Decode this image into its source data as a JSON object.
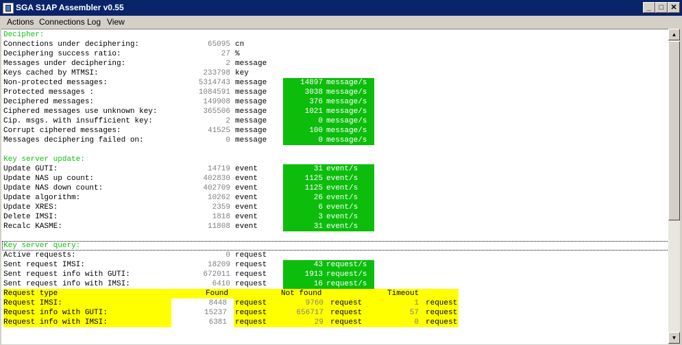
{
  "window": {
    "title": "SGA S1AP Assembler v0.55"
  },
  "titlebar_buttons": {
    "minimize": "_",
    "maximize": "□",
    "close": "✕"
  },
  "menu": [
    "Actions",
    "Connections",
    "Log",
    "View"
  ],
  "icons": {
    "app": "app-window-icon",
    "scroll_up": "▲",
    "scroll_down": "▼"
  },
  "colors": {
    "section": "#11c011",
    "rate_bg": "#0cbd0c",
    "table_bg": "#ffff00",
    "titlebar": "#0a246a"
  },
  "decipher": {
    "title": "Decipher:",
    "rows": [
      {
        "label": "Connections under deciphering:",
        "value": "65095",
        "unit": "cn"
      },
      {
        "label": "Deciphering success ratio:",
        "value": "27",
        "unit": "%"
      },
      {
        "label": "Messages under deciphering:",
        "value": "2",
        "unit": "message"
      },
      {
        "label": "Keys cached by MTMSI:",
        "value": "233798",
        "unit": "key"
      },
      {
        "label": "Non-protected messages:",
        "value": "5314743",
        "unit": "message",
        "rate": "14897",
        "rate_unit": "message/s"
      },
      {
        "label": "Protected messages :",
        "value": "1084591",
        "unit": "message",
        "rate": "3038",
        "rate_unit": "message/s"
      },
      {
        "label": "Deciphered messages:",
        "value": "149908",
        "unit": "message",
        "rate": "376",
        "rate_unit": "message/s"
      },
      {
        "label": "Ciphered messages use unknown key:",
        "value": "365506",
        "unit": "message",
        "rate": "1021",
        "rate_unit": "message/s"
      },
      {
        "label": "Cip. msgs. with insufficient key:",
        "value": "2",
        "unit": "message",
        "rate": "0",
        "rate_unit": "message/s"
      },
      {
        "label": "Corrupt ciphered messages:",
        "value": "41525",
        "unit": "message",
        "rate": "100",
        "rate_unit": "message/s"
      },
      {
        "label": "Messages deciphering failed on:",
        "value": "0",
        "unit": "message",
        "rate": "0",
        "rate_unit": "message/s"
      }
    ]
  },
  "key_update": {
    "title": "Key server update:",
    "rows": [
      {
        "label": "Update GUTI:",
        "value": "14719",
        "unit": "event",
        "rate": "31",
        "rate_unit": "event/s"
      },
      {
        "label": "Update NAS up count:",
        "value": "402830",
        "unit": "event",
        "rate": "1125",
        "rate_unit": "event/s"
      },
      {
        "label": "Update NAS down count:",
        "value": "402709",
        "unit": "event",
        "rate": "1125",
        "rate_unit": "event/s"
      },
      {
        "label": "Update algorithm:",
        "value": "10262",
        "unit": "event",
        "rate": "26",
        "rate_unit": "event/s"
      },
      {
        "label": "Update XRES:",
        "value": "2359",
        "unit": "event",
        "rate": "6",
        "rate_unit": "event/s"
      },
      {
        "label": "Delete IMSI:",
        "value": "1818",
        "unit": "event",
        "rate": "3",
        "rate_unit": "event/s"
      },
      {
        "label": "Recalc KASME:",
        "value": "11808",
        "unit": "event",
        "rate": "31",
        "rate_unit": "event/s"
      }
    ]
  },
  "key_query": {
    "title": "Key server query:",
    "rows": [
      {
        "label": "Active requests:",
        "value": "0",
        "unit": "request"
      },
      {
        "label": "Sent request IMSI:",
        "value": "18209",
        "unit": "request",
        "rate": "43",
        "rate_unit": "request/s"
      },
      {
        "label": "Sent request info with GUTI:",
        "value": "672011",
        "unit": "request",
        "rate": "1913",
        "rate_unit": "request/s"
      },
      {
        "label": "Sent request info with IMSI:",
        "value": "6410",
        "unit": "request",
        "rate": "16",
        "rate_unit": "request/s"
      }
    ]
  },
  "request_table": {
    "headers": [
      "Request type",
      "Found",
      "Not found",
      "Timeout"
    ],
    "rows": [
      {
        "label": "Request IMSI:",
        "found": "8448",
        "not_found": "9760",
        "timeout": "1",
        "unit": "request"
      },
      {
        "label": "Request info with GUTI:",
        "found": "15237",
        "not_found": "656717",
        "timeout": "57",
        "unit": "request"
      },
      {
        "label": "Request info with IMSI:",
        "found": "6381",
        "not_found": "29",
        "timeout": "0",
        "unit": "request"
      }
    ]
  }
}
